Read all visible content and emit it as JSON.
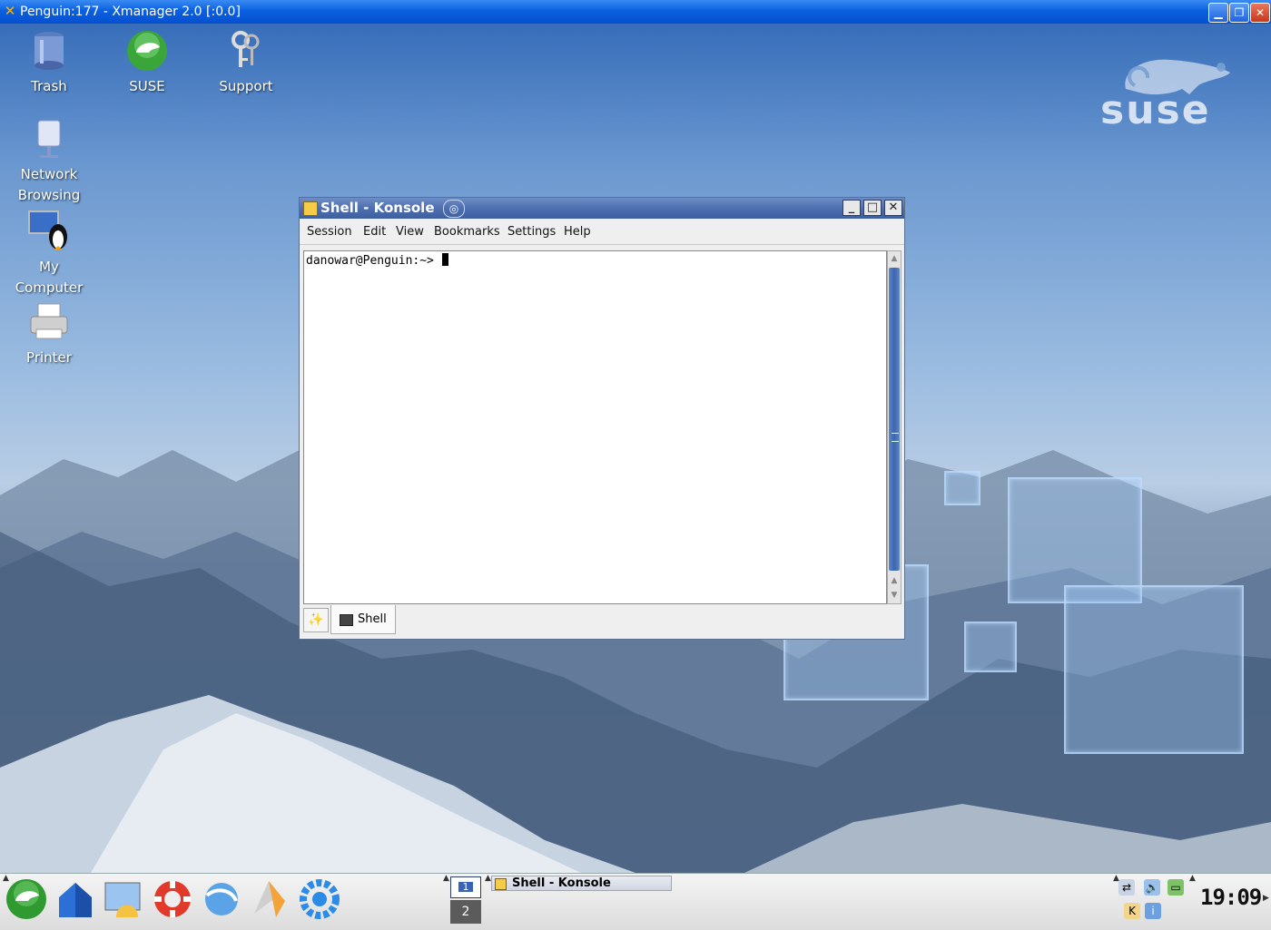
{
  "xmanager": {
    "title": "Penguin:177 - Xmanager 2.0 [:0.0]",
    "minimize": "▁",
    "restore": "❐",
    "close": "✕"
  },
  "desktop": {
    "icons": [
      {
        "label_lines": [
          "Trash"
        ]
      },
      {
        "label_lines": [
          "SUSE"
        ]
      },
      {
        "label_lines": [
          "Support"
        ]
      },
      {
        "label_lines": [
          "Network",
          "Browsing"
        ]
      },
      {
        "label_lines": [
          "My",
          "Computer"
        ]
      },
      {
        "label_lines": [
          "Printer"
        ]
      }
    ],
    "logo_text": "suse"
  },
  "konsole": {
    "title": "Shell - Konsole",
    "menu": [
      "Session",
      "Edit",
      "View",
      "Bookmarks",
      "Settings",
      "Help"
    ],
    "prompt": "danowar@Penguin:~> ",
    "tab_label": "Shell"
  },
  "taskbar": {
    "pager": {
      "desktop1": "1",
      "desktop2": "2"
    },
    "task_title": "Shell - Konsole",
    "clock": "19:09"
  },
  "colors": {
    "title_blue": "#0a5fe0",
    "konsole_title": "#4d6fb1",
    "scroll_thumb": "#3c66b0"
  }
}
